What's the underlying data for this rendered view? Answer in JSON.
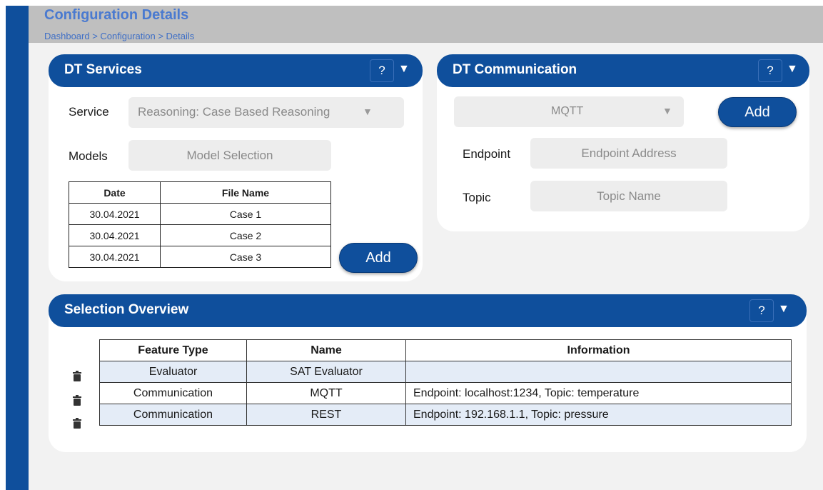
{
  "page": {
    "title": "Configuration Details",
    "breadcrumb": "Dashboard > Configuration > Details"
  },
  "dt_services": {
    "title": "DT Services",
    "help_label": "?",
    "service_label": "Service",
    "service_value": "Reasoning: Case Based Reasoning",
    "models_label": "Models",
    "models_placeholder": "Model Selection",
    "table": {
      "headers": [
        "Date",
        "File Name"
      ],
      "rows": [
        [
          "30.04.2021",
          "Case 1"
        ],
        [
          "30.04.2021",
          "Case 2"
        ],
        [
          "30.04.2021",
          "Case 3"
        ]
      ]
    },
    "add_label": "Add"
  },
  "dt_communication": {
    "title": "DT Communication",
    "help_label": "?",
    "protocol_value": "MQTT",
    "add_label": "Add",
    "endpoint_label": "Endpoint",
    "endpoint_placeholder": "Endpoint Address",
    "topic_label": "Topic",
    "topic_placeholder": "Topic Name"
  },
  "selection_overview": {
    "title": "Selection Overview",
    "help_label": "?",
    "headers": [
      "Feature Type",
      "Name",
      "Information"
    ],
    "rows": [
      [
        "Evaluator",
        "SAT Evaluator",
        ""
      ],
      [
        "Communication",
        "MQTT",
        "Endpoint: localhost:1234, Topic: temperature"
      ],
      [
        "Communication",
        "REST",
        "Endpoint: 192.168.1.1, Topic: pressure"
      ]
    ]
  },
  "icons": {
    "collapse": "chevron-down-icon",
    "dropdown": "dropdown-arrow-icon",
    "delete": "trash-icon"
  },
  "colors": {
    "brand_blue": "#0f4f9c",
    "title_blue": "#4a7ad0",
    "row_shade": "#e4ecf7",
    "background": "#f2f2f2",
    "header_gray": "#bfbfbf"
  }
}
